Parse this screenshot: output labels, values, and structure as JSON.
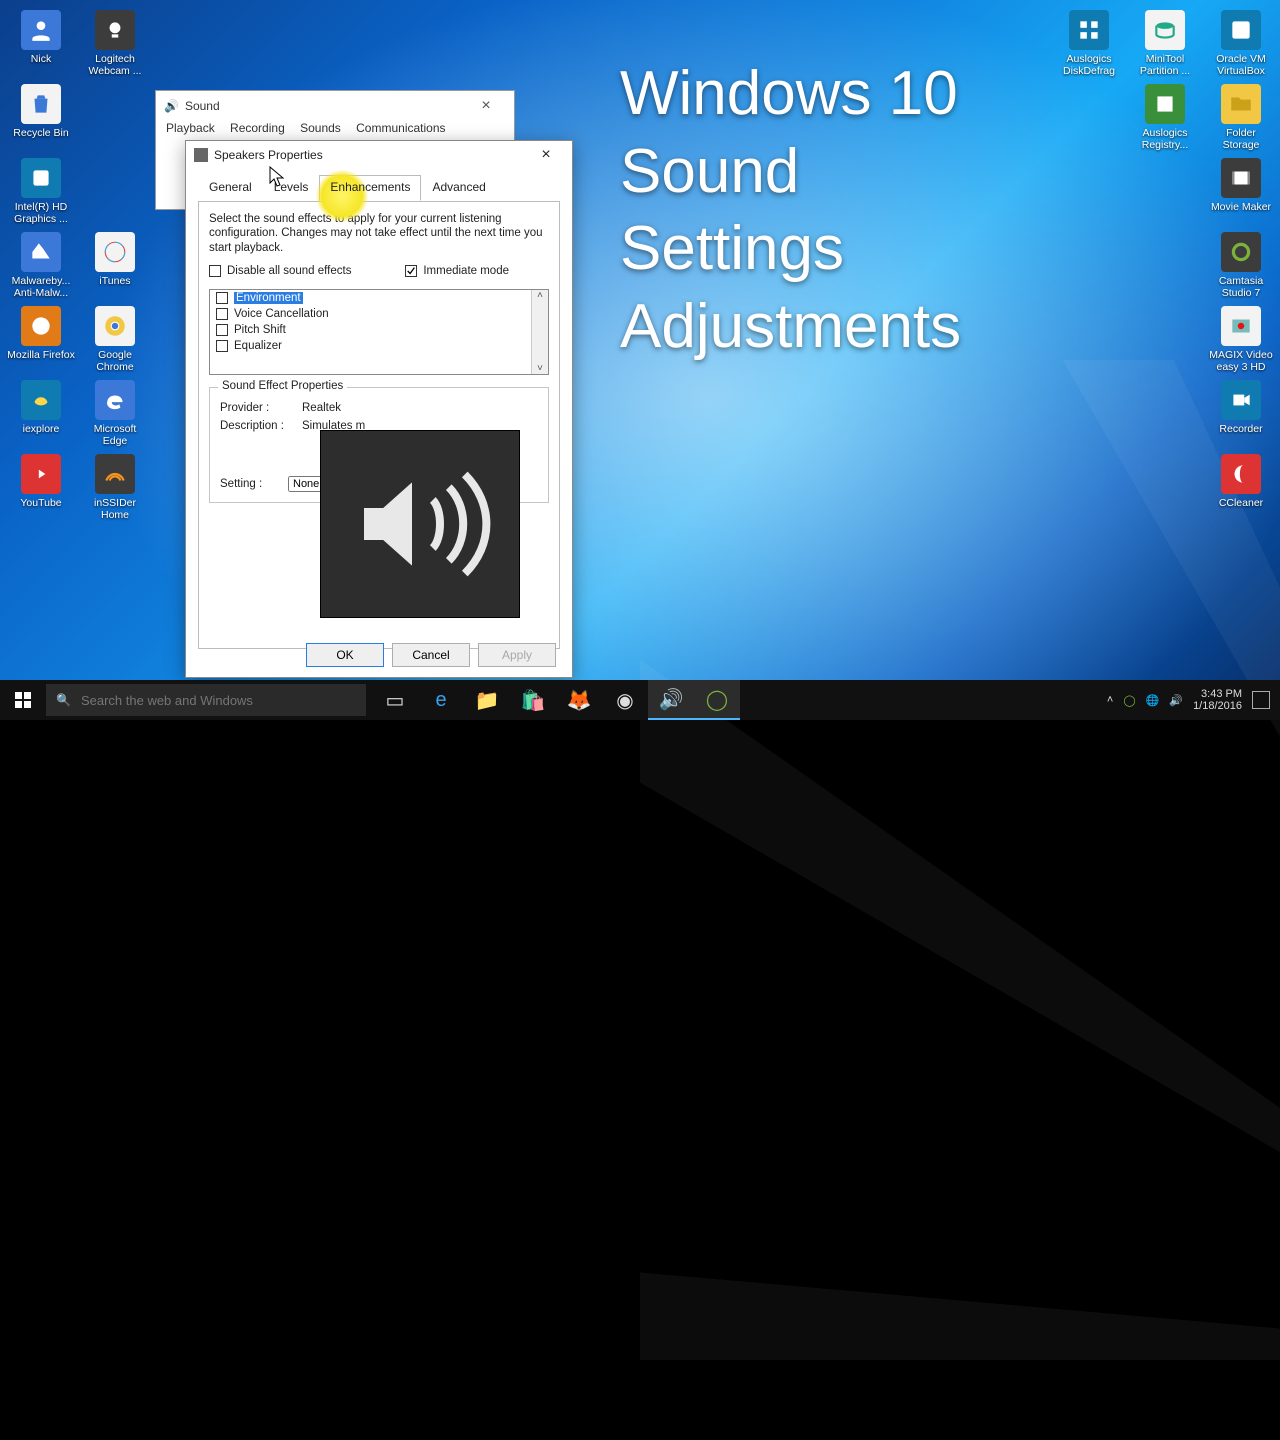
{
  "overlay": {
    "title_l1": "Windows 10",
    "title_l2": "Sound",
    "title_l3": "Settings",
    "title_l4": "Adjustments"
  },
  "desktop_icons": {
    "left": [
      "Nick",
      "Recycle Bin",
      "Intel(R) HD Graphics ...",
      "Malwareby... Anti-Malw...",
      "Mozilla Firefox",
      "iexplore",
      "YouTube"
    ],
    "left2": [
      "Logitech Webcam ...",
      "",
      "",
      "iTunes",
      "Google Chrome",
      "Microsoft Edge",
      "inSSIDer Home"
    ],
    "right": [
      "Oracle VM VirtualBox",
      "Folder Storage",
      "Movie Maker",
      "Camtasia Studio 7",
      "MAGIX Video easy 3 HD",
      "Recorder",
      "CCleaner"
    ],
    "right2": [
      "MiniTool Partition ...",
      "Auslogics Registry...",
      "",
      "",
      "",
      "",
      ""
    ],
    "topmid": [
      "Auslogics DiskDefrag"
    ]
  },
  "sound_window": {
    "title": "Sound",
    "tabs": [
      "Playback",
      "Recording",
      "Sounds",
      "Communications"
    ]
  },
  "props_window": {
    "title": "Speakers Properties",
    "tabs": [
      "General",
      "Levels",
      "Enhancements",
      "Advanced"
    ],
    "active_tab": "Enhancements",
    "description": "Select the sound effects to apply for your current listening configuration. Changes may not take effect until the next time you start playback.",
    "disable_all_label": "Disable all sound effects",
    "immediate_label": "Immediate mode",
    "immediate_checked": true,
    "effects": [
      "Environment",
      "Voice Cancellation",
      "Pitch Shift",
      "Equalizer"
    ],
    "selected_effect_index": 0,
    "group_legend": "Sound Effect Properties",
    "provider_label": "Provider :",
    "provider_value": "Realtek",
    "description_label": "Description :",
    "description_value": "Simulates m",
    "setting_label": "Setting :",
    "setting_value": "None",
    "btn_ok": "OK",
    "btn_cancel": "Cancel",
    "btn_apply": "Apply"
  },
  "taskbar": {
    "search_placeholder": "Search the web and Windows",
    "tray_up": "˄",
    "time": "3:43 PM",
    "date": "1/18/2016"
  }
}
